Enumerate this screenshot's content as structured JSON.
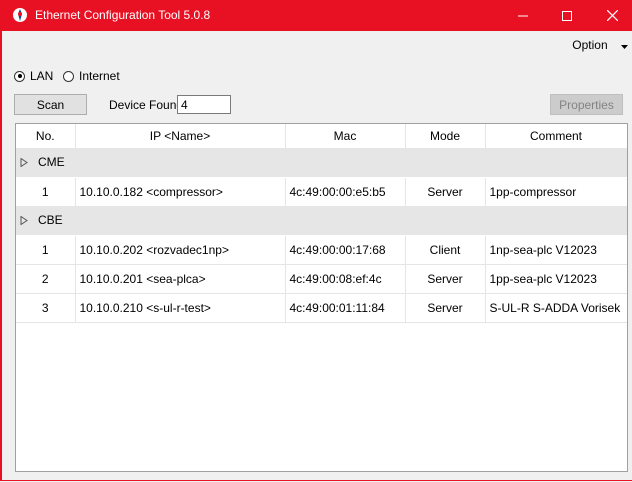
{
  "window": {
    "title": "Ethernet Configuration Tool 5.0.8",
    "colors": {
      "titlebar": "#e81123",
      "window_bg": "#f0f0f0"
    }
  },
  "menu": {
    "option_label": "Option"
  },
  "connection": {
    "lan_label": "LAN",
    "internet_label": "Internet",
    "selected": "LAN"
  },
  "toolbar": {
    "scan_label": "Scan",
    "device_found_label": "Device Found",
    "device_found_value": "4",
    "properties_label": "Properties"
  },
  "table": {
    "headers": {
      "no": "No.",
      "ip": "IP <Name>",
      "mac": "Mac",
      "mode": "Mode",
      "comment": "Comment"
    },
    "groups": [
      {
        "name": "CME",
        "rows": [
          {
            "no": "1",
            "ip": "10.10.0.182 <compressor>",
            "mac": "4c:49:00:00:e5:b5",
            "mode": "Server",
            "comment": "1pp-compressor"
          }
        ]
      },
      {
        "name": "CBE",
        "rows": [
          {
            "no": "1",
            "ip": "10.10.0.202 <rozvadec1np>",
            "mac": "4c:49:00:00:17:68",
            "mode": "Client",
            "comment": "1np-sea-plc V12023"
          },
          {
            "no": "2",
            "ip": "10.10.0.201 <sea-plca>",
            "mac": "4c:49:00:08:ef:4c",
            "mode": "Server",
            "comment": "1pp-sea-plc V12023"
          },
          {
            "no": "3",
            "ip": "10.10.0.210 <s-ul-r-test>",
            "mac": "4c:49:00:01:11:84",
            "mode": "Server",
            "comment": "S-UL-R S-ADDA Vorisek"
          }
        ]
      }
    ]
  },
  "icons": {
    "app": "app-icon",
    "minimize": "minimize-icon",
    "maximize": "maximize-icon",
    "close": "close-icon",
    "group_expand": "triangle-right-icon",
    "dropdown": "chevron-down-icon"
  }
}
